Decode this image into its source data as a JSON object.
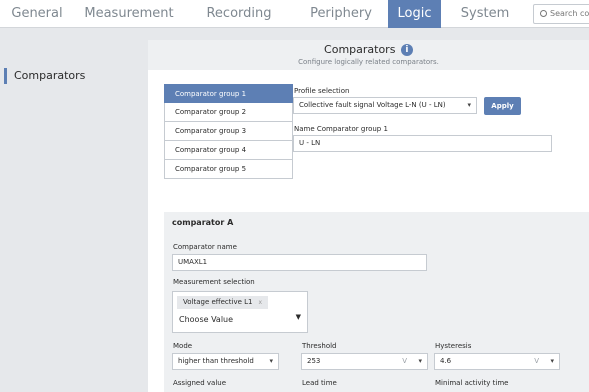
{
  "nav": {
    "tabs": [
      "General",
      "Measurement",
      "Recording",
      "Periphery",
      "Logic",
      "System"
    ],
    "active": "Logic",
    "search_placeholder": "Search cor"
  },
  "sidebar": {
    "items": [
      {
        "label": "Comparators"
      }
    ]
  },
  "page": {
    "title": "Comparators",
    "subtitle": "Configure logically related comparators.",
    "info_icon": "i"
  },
  "groups": [
    "Comparator group 1",
    "Comparator group 2",
    "Comparator group 3",
    "Comparator group 4",
    "Comparator group 5"
  ],
  "selected_group": "Comparator group 1",
  "profile": {
    "label": "Profile selection",
    "value": "Collective fault signal Voltage L-N (U - LN)",
    "apply": "Apply"
  },
  "group_name": {
    "label": "Name Comparator group 1",
    "value": "U - LN"
  },
  "comparator": {
    "title": "comparator A",
    "name_label": "Comparator name",
    "name_value": "UMAXL1",
    "meas_label": "Measurement selection",
    "meas_chip": "Voltage effective L1",
    "meas_chip_remove": "x",
    "meas_placeholder": "Choose Value",
    "mode_label": "Mode",
    "mode_value": "higher than threshold",
    "threshold_label": "Threshold",
    "threshold_value": "253",
    "threshold_unit": "V",
    "hysteresis_label": "Hysteresis",
    "hysteresis_value": "4.6",
    "hysteresis_unit": "V",
    "assigned_label": "Assigned value",
    "lead_label": "Lead time",
    "min_activity_label": "Minimal activity time"
  },
  "colors": {
    "accent": "#5d7fb4",
    "panel": "#eef0f2",
    "background": "#e6e8eb"
  }
}
